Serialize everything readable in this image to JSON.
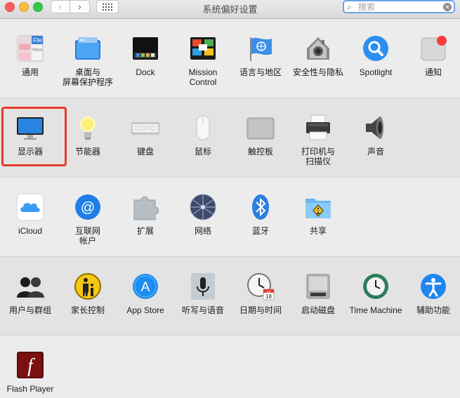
{
  "window": {
    "title": "系统偏好设置",
    "back_glyph": "‹",
    "forward_glyph": "›",
    "search_placeholder": "搜索",
    "clear_glyph": "✕",
    "search_glyph": "⌕"
  },
  "sections": [
    {
      "items": [
        {
          "name": "pane-general",
          "label": "通用",
          "icon": "general-icon"
        },
        {
          "name": "pane-desktop-screensaver",
          "label": "桌面与\n屏幕保护程序",
          "icon": "desktop-screensaver-icon"
        },
        {
          "name": "pane-dock",
          "label": "Dock",
          "icon": "dock-icon"
        },
        {
          "name": "pane-mission-control",
          "label": "Mission\nControl",
          "icon": "mission-control-icon"
        },
        {
          "name": "pane-language-region",
          "label": "语言与地区",
          "icon": "language-region-icon"
        },
        {
          "name": "pane-security-privacy",
          "label": "安全性与隐私",
          "icon": "security-icon"
        },
        {
          "name": "pane-spotlight",
          "label": "Spotlight",
          "icon": "spotlight-icon"
        },
        {
          "name": "pane-notifications",
          "label": "通知",
          "icon": "notifications-icon"
        }
      ]
    },
    {
      "items": [
        {
          "name": "pane-displays",
          "label": "显示器",
          "icon": "displays-icon"
        },
        {
          "name": "pane-energy-saver",
          "label": "节能器",
          "icon": "energy-saver-icon"
        },
        {
          "name": "pane-keyboard",
          "label": "键盘",
          "icon": "keyboard-icon"
        },
        {
          "name": "pane-mouse",
          "label": "鼠标",
          "icon": "mouse-icon"
        },
        {
          "name": "pane-trackpad",
          "label": "触控板",
          "icon": "trackpad-icon"
        },
        {
          "name": "pane-printers-scanners",
          "label": "打印机与\n扫描仪",
          "icon": "printer-icon"
        },
        {
          "name": "pane-sound",
          "label": "声音",
          "icon": "sound-icon"
        }
      ]
    },
    {
      "items": [
        {
          "name": "pane-icloud",
          "label": "iCloud",
          "icon": "icloud-icon"
        },
        {
          "name": "pane-internet-accounts",
          "label": "互联网\n帐户",
          "icon": "internet-accounts-icon"
        },
        {
          "name": "pane-extensions",
          "label": "扩展",
          "icon": "extensions-icon"
        },
        {
          "name": "pane-network",
          "label": "网络",
          "icon": "network-icon"
        },
        {
          "name": "pane-bluetooth",
          "label": "蓝牙",
          "icon": "bluetooth-icon"
        },
        {
          "name": "pane-sharing",
          "label": "共享",
          "icon": "sharing-icon"
        }
      ]
    },
    {
      "items": [
        {
          "name": "pane-users-groups",
          "label": "用户与群组",
          "icon": "users-groups-icon"
        },
        {
          "name": "pane-parental-controls",
          "label": "家长控制",
          "icon": "parental-controls-icon"
        },
        {
          "name": "pane-app-store",
          "label": "App Store",
          "icon": "app-store-icon"
        },
        {
          "name": "pane-dictation-speech",
          "label": "听写与语音",
          "icon": "microphone-icon"
        },
        {
          "name": "pane-date-time",
          "label": "日期与时间",
          "icon": "clock-icon"
        },
        {
          "name": "pane-startup-disk",
          "label": "启动磁盘",
          "icon": "startup-disk-icon"
        },
        {
          "name": "pane-time-machine",
          "label": "Time Machine",
          "icon": "time-machine-icon"
        },
        {
          "name": "pane-accessibility",
          "label": "辅助功能",
          "icon": "accessibility-icon"
        }
      ]
    },
    {
      "items": [
        {
          "name": "pane-flash-player",
          "label": "Flash Player",
          "icon": "flash-player-icon"
        }
      ]
    }
  ],
  "icon_text": {
    "general_file": "File",
    "general_new": "New",
    "app_store_glyph": "A",
    "flash_glyph": "f",
    "internet_glyph": "@",
    "calendar_month": "JUL",
    "calendar_day": "18"
  },
  "colors": {
    "highlight_border": "#e53b2c",
    "search_focus": "#6fa2e5",
    "notification_badge": "#fa3c3c"
  }
}
